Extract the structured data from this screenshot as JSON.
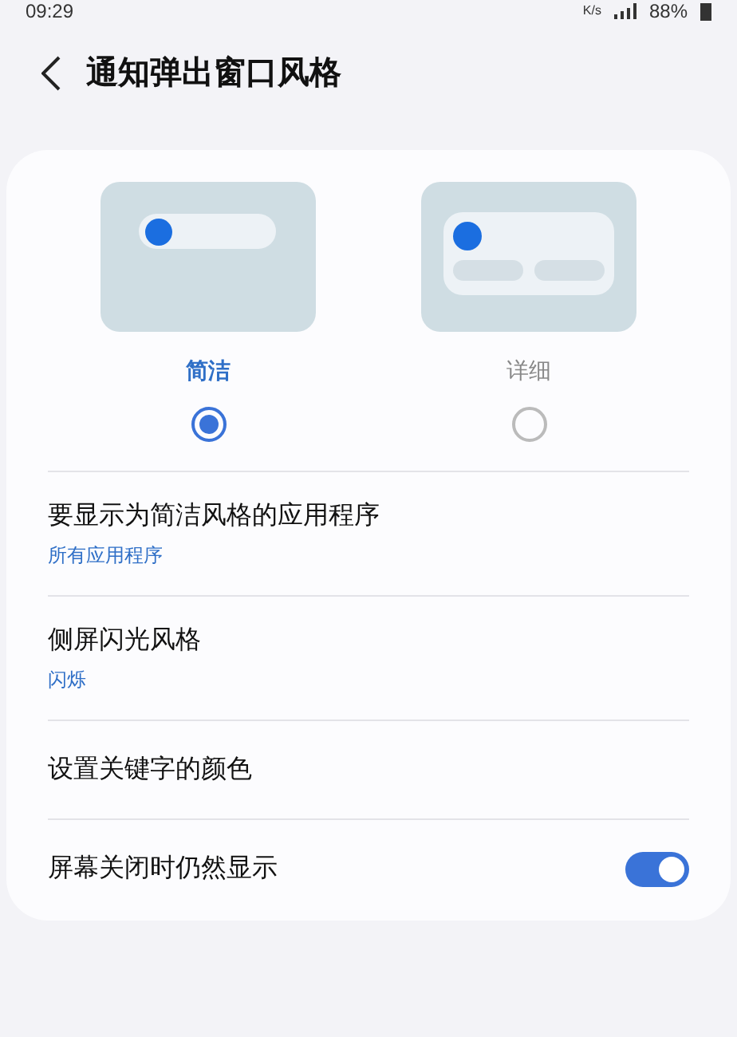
{
  "status_bar": {
    "time": "09:29",
    "speed": "K/s",
    "battery": "88%"
  },
  "header": {
    "title": "通知弹出窗口风格"
  },
  "styles": [
    {
      "label": "简洁",
      "kind": "brief",
      "selected": true
    },
    {
      "label": "详细",
      "kind": "detailed",
      "selected": false
    }
  ],
  "settings": [
    {
      "kind": "link",
      "title": "要显示为简洁风格的应用程序",
      "value": "所有应用程序"
    },
    {
      "kind": "link",
      "title": "侧屏闪光风格",
      "value": "闪烁"
    },
    {
      "kind": "plain",
      "title": "设置关键字的颜色"
    },
    {
      "kind": "toggle",
      "title": "屏幕关闭时仍然显示",
      "on": true
    }
  ]
}
